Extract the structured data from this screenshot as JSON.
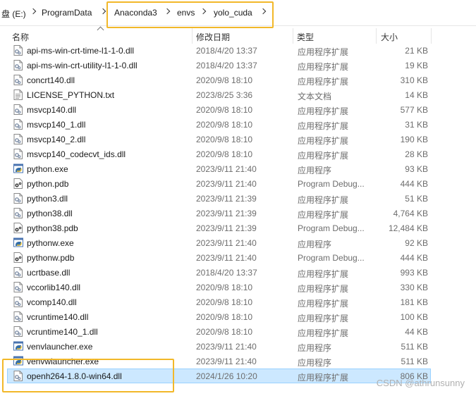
{
  "breadcrumb": [
    {
      "label": "盘 (E:)"
    },
    {
      "label": "ProgramData"
    },
    {
      "label": "Anaconda3"
    },
    {
      "label": "envs"
    },
    {
      "label": "yolo_cuda"
    }
  ],
  "columns": {
    "name": "名称",
    "date": "修改日期",
    "type": "类型",
    "size": "大小"
  },
  "files": [
    {
      "name": "api-ms-win-crt-time-l1-1-0.dll",
      "date": "2018/4/20 13:37",
      "type": "应用程序扩展",
      "size": "21 KB",
      "icon": "dll-icon"
    },
    {
      "name": "api-ms-win-crt-utility-l1-1-0.dll",
      "date": "2018/4/20 13:37",
      "type": "应用程序扩展",
      "size": "19 KB",
      "icon": "dll-icon"
    },
    {
      "name": "concrt140.dll",
      "date": "2020/9/8 18:10",
      "type": "应用程序扩展",
      "size": "310 KB",
      "icon": "dll-icon"
    },
    {
      "name": "LICENSE_PYTHON.txt",
      "date": "2023/8/25 3:36",
      "type": "文本文档",
      "size": "14 KB",
      "icon": "txt-icon"
    },
    {
      "name": "msvcp140.dll",
      "date": "2020/9/8 18:10",
      "type": "应用程序扩展",
      "size": "577 KB",
      "icon": "dll-icon"
    },
    {
      "name": "msvcp140_1.dll",
      "date": "2020/9/8 18:10",
      "type": "应用程序扩展",
      "size": "31 KB",
      "icon": "dll-icon"
    },
    {
      "name": "msvcp140_2.dll",
      "date": "2020/9/8 18:10",
      "type": "应用程序扩展",
      "size": "190 KB",
      "icon": "dll-icon"
    },
    {
      "name": "msvcp140_codecvt_ids.dll",
      "date": "2020/9/8 18:10",
      "type": "应用程序扩展",
      "size": "28 KB",
      "icon": "dll-icon"
    },
    {
      "name": "python.exe",
      "date": "2023/9/11 21:40",
      "type": "应用程序",
      "size": "93 KB",
      "icon": "python-exe-icon"
    },
    {
      "name": "python.pdb",
      "date": "2023/9/11 21:40",
      "type": "Program Debug...",
      "size": "444 KB",
      "icon": "pdb-icon"
    },
    {
      "name": "python3.dll",
      "date": "2023/9/11 21:39",
      "type": "应用程序扩展",
      "size": "51 KB",
      "icon": "dll-icon"
    },
    {
      "name": "python38.dll",
      "date": "2023/9/11 21:39",
      "type": "应用程序扩展",
      "size": "4,764 KB",
      "icon": "dll-icon"
    },
    {
      "name": "python38.pdb",
      "date": "2023/9/11 21:39",
      "type": "Program Debug...",
      "size": "12,484 KB",
      "icon": "pdb-icon"
    },
    {
      "name": "pythonw.exe",
      "date": "2023/9/11 21:40",
      "type": "应用程序",
      "size": "92 KB",
      "icon": "python-exe-icon"
    },
    {
      "name": "pythonw.pdb",
      "date": "2023/9/11 21:40",
      "type": "Program Debug...",
      "size": "444 KB",
      "icon": "pdb-icon"
    },
    {
      "name": "ucrtbase.dll",
      "date": "2018/4/20 13:37",
      "type": "应用程序扩展",
      "size": "993 KB",
      "icon": "dll-icon"
    },
    {
      "name": "vccorlib140.dll",
      "date": "2020/9/8 18:10",
      "type": "应用程序扩展",
      "size": "330 KB",
      "icon": "dll-icon"
    },
    {
      "name": "vcomp140.dll",
      "date": "2020/9/8 18:10",
      "type": "应用程序扩展",
      "size": "181 KB",
      "icon": "dll-icon"
    },
    {
      "name": "vcruntime140.dll",
      "date": "2020/9/8 18:10",
      "type": "应用程序扩展",
      "size": "100 KB",
      "icon": "dll-icon"
    },
    {
      "name": "vcruntime140_1.dll",
      "date": "2020/9/8 18:10",
      "type": "应用程序扩展",
      "size": "44 KB",
      "icon": "dll-icon"
    },
    {
      "name": "venvlauncher.exe",
      "date": "2023/9/11 21:40",
      "type": "应用程序",
      "size": "511 KB",
      "icon": "python-exe-icon"
    },
    {
      "name": "venvwlauncher.exe",
      "date": "2023/9/11 21:40",
      "type": "应用程序",
      "size": "511 KB",
      "icon": "python-exe-icon"
    },
    {
      "name": "openh264-1.8.0-win64.dll",
      "date": "2024/1/26 10:20",
      "type": "应用程序扩展",
      "size": "806 KB",
      "icon": "dll-icon",
      "selected": true
    }
  ],
  "watermark": "CSDN @athrunsunny",
  "colors": {
    "annotation": "#f2b829",
    "selection": "#cce8ff",
    "selection_border": "#99d1ff"
  }
}
